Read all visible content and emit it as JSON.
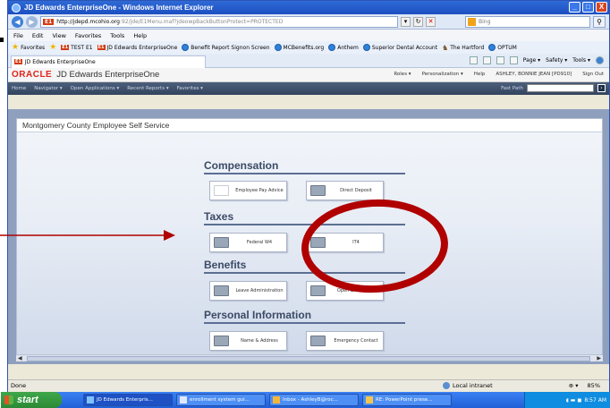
{
  "window": {
    "title": "JD Edwards EnterpriseOne - Windows Internet Explorer",
    "controls": [
      "_",
      "□",
      "X"
    ]
  },
  "address": {
    "host": "http://jdepd.mcohio.org",
    "path": ":92/jde/E1Menu.maf?jdeowpBackButtonProtect=PROTECTED",
    "search_placeholder": "Bing"
  },
  "menu": [
    "File",
    "Edit",
    "View",
    "Favorites",
    "Tools",
    "Help"
  ],
  "favorites": {
    "label": "Favorites",
    "items": [
      "TEST E1",
      "JD Edwards EnterpriseOne",
      "Benefit Report Signon Screen",
      "MCBenefits.org",
      "Anthem",
      "Superior Dental Account",
      "The Hartford",
      "OPTUM"
    ]
  },
  "tab": {
    "label": "JD Edwards EnterpriseOne"
  },
  "commands": [
    "Page ▾",
    "Safety ▾",
    "Tools ▾"
  ],
  "jde": {
    "brand": "ORACLE",
    "title": "JD Edwards EnterpriseOne",
    "links": [
      "Roles ▾",
      "Personalization ▾",
      "Help",
      "ASHLEY, BONNIE JEAN  [PD910]",
      "Sign Out"
    ],
    "nav": [
      "Home",
      "Navigator ▾",
      "Open Applications ▾",
      "Recent Reports ▾",
      "Favorites ▾"
    ],
    "fast_path_label": "Fast Path"
  },
  "page": {
    "title": "Montgomery County Employee Self Service",
    "sections": {
      "compensation": {
        "title": "Compensation",
        "tiles": [
          "Employee Pay Advice",
          "Direct Deposit"
        ]
      },
      "taxes": {
        "title": "Taxes",
        "tiles": [
          "Federal W4",
          "IT4"
        ]
      },
      "benefits": {
        "title": "Benefits",
        "tiles": [
          "Leave Administration",
          "Open Enrollment"
        ]
      },
      "personal": {
        "title": "Personal Information",
        "tiles": [
          "Name & Address",
          "Emergency Contact"
        ]
      }
    }
  },
  "status": {
    "left": "Done",
    "zone": "Local intranet",
    "zoom": "85%"
  },
  "taskbar": {
    "start": "start",
    "tasks": [
      "JD Edwards Enterpris...",
      "enrollment system gui...",
      "Inbox - AshleyB@roc...",
      "RE: PowerPoint prese..."
    ],
    "time": "8:57 AM"
  },
  "colors": {
    "annotation_red": "#b00000",
    "oracle_red": "#e2231a",
    "section_blue": "#3b4a66"
  }
}
